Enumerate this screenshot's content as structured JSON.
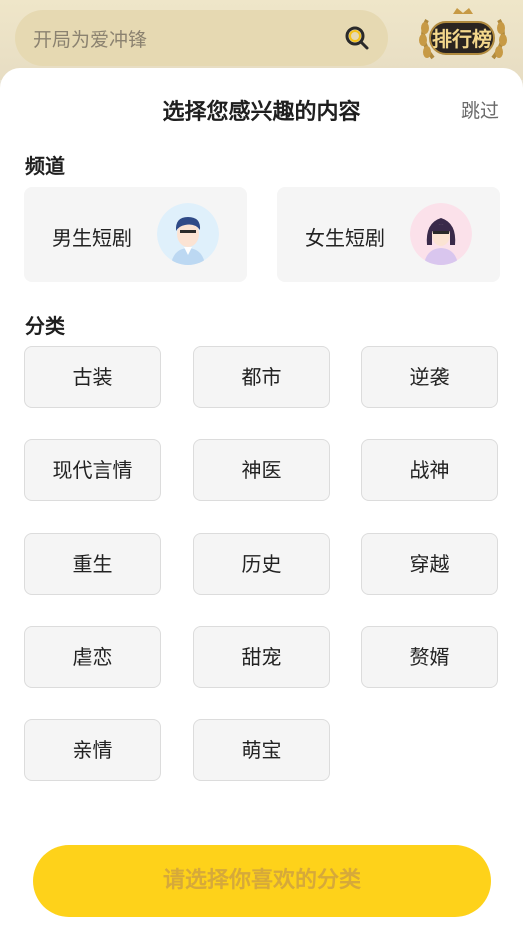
{
  "header": {
    "search_placeholder": "开局为爱冲锋",
    "ranking_label": "排行榜"
  },
  "modal": {
    "title": "选择您感兴趣的内容",
    "skip": "跳过",
    "channel_heading": "频道",
    "channels": [
      {
        "label": "男生短剧",
        "avatar": "male-avatar-icon"
      },
      {
        "label": "女生短剧",
        "avatar": "female-avatar-icon"
      }
    ],
    "category_heading": "分类",
    "categories": [
      "古装",
      "都市",
      "逆袭",
      "现代言情",
      "神医",
      "战神",
      "重生",
      "历史",
      "穿越",
      "虐恋",
      "甜宠",
      "赘婿",
      "亲情",
      "萌宝"
    ],
    "submit_label": "请选择你喜欢的分类"
  },
  "colors": {
    "accent": "#fed21a",
    "submit_text": "#d6a93a",
    "card_bg": "#f5f5f5"
  }
}
